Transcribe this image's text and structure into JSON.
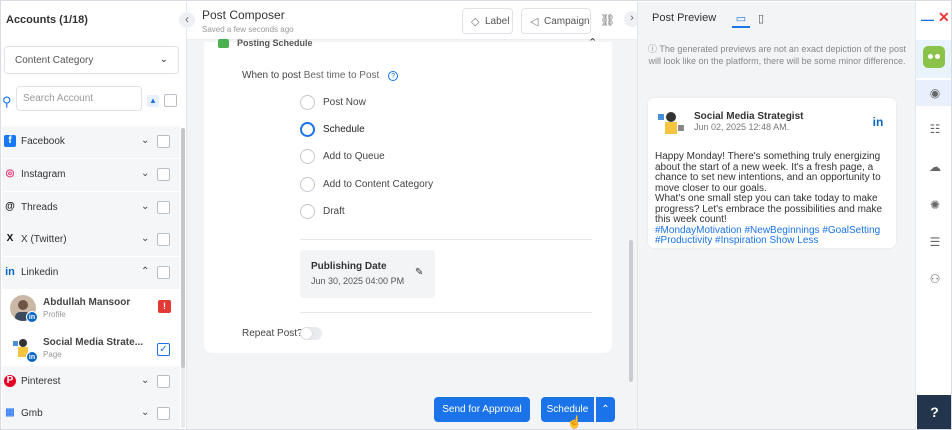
{
  "accounts_panel": {
    "title": "Accounts (1/18)",
    "category_select": "Content Category",
    "search_placeholder": "Search Account",
    "networks": [
      {
        "name": "Facebook",
        "icon": "facebook-icon",
        "color": "#1877f2",
        "glyph": "f"
      },
      {
        "name": "Instagram",
        "icon": "instagram-icon",
        "color": "#e1306c",
        "glyph": "◎"
      },
      {
        "name": "Threads",
        "icon": "threads-icon",
        "color": "#111111",
        "glyph": "@"
      },
      {
        "name": "X (Twitter)",
        "icon": "x-twitter-icon",
        "color": "#111111",
        "glyph": "X"
      },
      {
        "name": "Linkedin",
        "icon": "linkedin-icon",
        "color": "#0a66c2",
        "glyph": "in"
      },
      {
        "name": "Pinterest",
        "icon": "pinterest-icon",
        "color": "#e60023",
        "glyph": "P"
      },
      {
        "name": "Gmb",
        "icon": "gmb-icon",
        "color": "#4285f4",
        "glyph": "▦"
      }
    ],
    "linkedin_accounts": [
      {
        "name": "Abdullah Mansoor",
        "type": "Profile",
        "warning": "!",
        "checked": false
      },
      {
        "name": "Social Media Strate...",
        "type": "Page",
        "checked": true
      }
    ]
  },
  "composer": {
    "title": "Post Composer",
    "saved": "Saved a few seconds ago",
    "label_btn": "Label",
    "campaign_btn": "Campaign",
    "section_title": "Posting Schedule",
    "when_label": "When to post",
    "best_time": "Best time to Post",
    "options": [
      "Post Now",
      "Schedule",
      "Add to Queue",
      "Add to Content Category",
      "Draft"
    ],
    "selected_option": "Schedule",
    "publishing_date_label": "Publishing Date",
    "publishing_date_value": "Jun 30, 2025 04:00 PM",
    "repeat_label": "Repeat Post?",
    "send_approval": "Send for Approval",
    "schedule_btn": "Schedule"
  },
  "preview": {
    "title": "Post Preview",
    "notice": "The generated previews are not an exact depiction of the post will look like on the platform, there will be some minor difference.",
    "account_name": "Social Media Strategist",
    "post_date": "Jun 02, 2025 12:48 AM.",
    "network_badge": "in",
    "body_1": "Happy Monday! There's something truly energizing about the start of a new week. It's a fresh page, a chance to set new intentions, and an opportunity to move closer to our goals.",
    "body_2": "What's one small step you can take today to make progress? Let's embrace the possibilities and make this week count!",
    "hashtags": "#MondayMotivation #NewBeginnings #GoalSetting #Productivity #Inspiration",
    "show_less": "Show Less"
  },
  "rail": {
    "help": "?"
  },
  "colors": {
    "accent": "#1a73e8",
    "help_bg": "#23344d",
    "ai_bot": "#8bc34a"
  }
}
